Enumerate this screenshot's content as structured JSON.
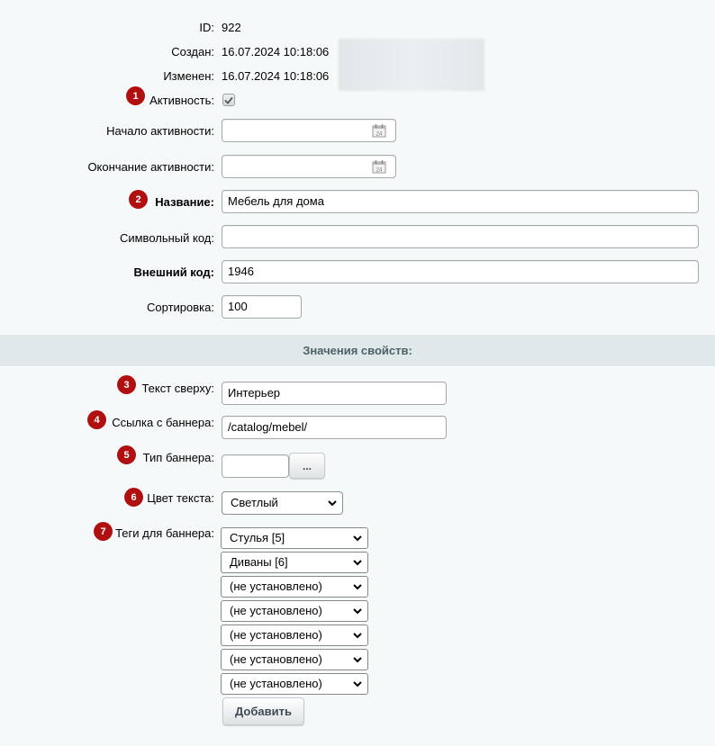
{
  "meta": {
    "id_label": "ID:",
    "id_value": "922",
    "created_label": "Создан:",
    "created_value": "16.07.2024 10:18:06",
    "modified_label": "Изменен:",
    "modified_value": "16.07.2024 10:18:06"
  },
  "fields": {
    "active_label": "Активность:",
    "active_checked": true,
    "start_label": "Начало активности:",
    "start_value": "",
    "end_label": "Окончание активности:",
    "end_value": "",
    "name_label": "Название:",
    "name_value": "Мебель для дома",
    "code_label": "Символьный код:",
    "code_value": "",
    "xml_label": "Внешний код:",
    "xml_value": "1946",
    "sort_label": "Сортировка:",
    "sort_value": "100"
  },
  "section": {
    "title": "Значения свойств:"
  },
  "props": {
    "top_text_label": "Текст сверху:",
    "top_text_value": "Интерьер",
    "link_label": "Ссылка с баннера:",
    "link_value": "/catalog/mebel/",
    "type_label": "Тип баннера:",
    "type_value": "",
    "type_button": "...",
    "color_label": "Цвет текста:",
    "color_value": "Светлый",
    "tags_label": "Теги для баннера:",
    "tags": [
      "Стулья [5]",
      "Диваны [6]",
      "(не установлено)",
      "(не установлено)",
      "(не установлено)",
      "(не установлено)",
      "(не установлено)"
    ],
    "add_button": "Добавить"
  },
  "badges": [
    "1",
    "2",
    "3",
    "4",
    "5",
    "6",
    "7"
  ],
  "colors": {
    "badge": "#b01010",
    "background": "#f5f9f9",
    "section_bg": "#e0e8ea",
    "section_text": "#4b6267"
  },
  "icons": {
    "calendar": "calendar-icon",
    "chevron": "chevron-down-icon",
    "check": "check-icon"
  }
}
